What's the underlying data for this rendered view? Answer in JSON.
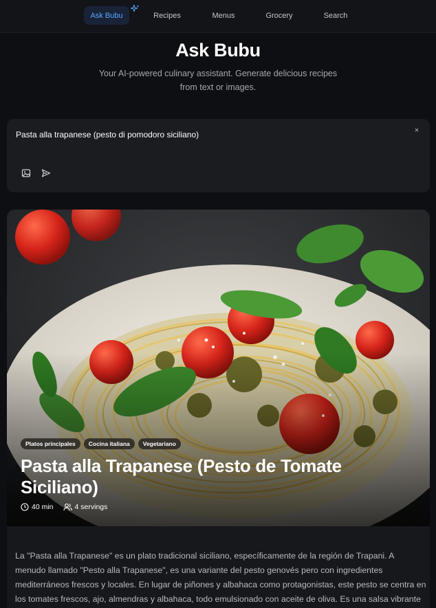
{
  "nav": {
    "items": [
      {
        "label": "Ask Bubu",
        "active": true
      },
      {
        "label": "Recipes",
        "active": false
      },
      {
        "label": "Menus",
        "active": false
      },
      {
        "label": "Grocery",
        "active": false
      },
      {
        "label": "Search",
        "active": false
      }
    ],
    "sparkle_icon": "sparkle-icon"
  },
  "hero": {
    "title": "Ask Bubu",
    "subtitle": "Your AI-powered culinary assistant. Generate delicious recipes from text or images."
  },
  "prompt": {
    "value": "Pasta alla trapanese (pesto di pomodoro siciliano)",
    "close_glyph": "×",
    "icons": [
      "image-icon",
      "send-icon"
    ]
  },
  "recipe": {
    "tags": [
      "Platos principales",
      "Cocina italiana",
      "Vegetariano"
    ],
    "title": "Pasta alla Trapanese (Pesto de Tomate Siciliano)",
    "time": "40 min",
    "servings": "4 servings",
    "description": "La \"Pasta alla Trapanese\" es un plato tradicional siciliano, específicamente de la región de Trapani. A menudo llamado \"Pesto alla Trapanese\", es una variante del pesto genovés pero con ingredientes mediterráneos frescos y locales. En lugar de piñones y albahaca como protagonistas, este pesto se centra en los tomates frescos, ajo, almendras y albahaca, todo emulsionado con aceite de oliva. Es una salsa vibrante y sabrosa que es perfecta para cualquier tipo de pasta."
  },
  "colors": {
    "accent": "#5aa4ff",
    "background": "#0e0f12",
    "card": "#1b1c20"
  }
}
